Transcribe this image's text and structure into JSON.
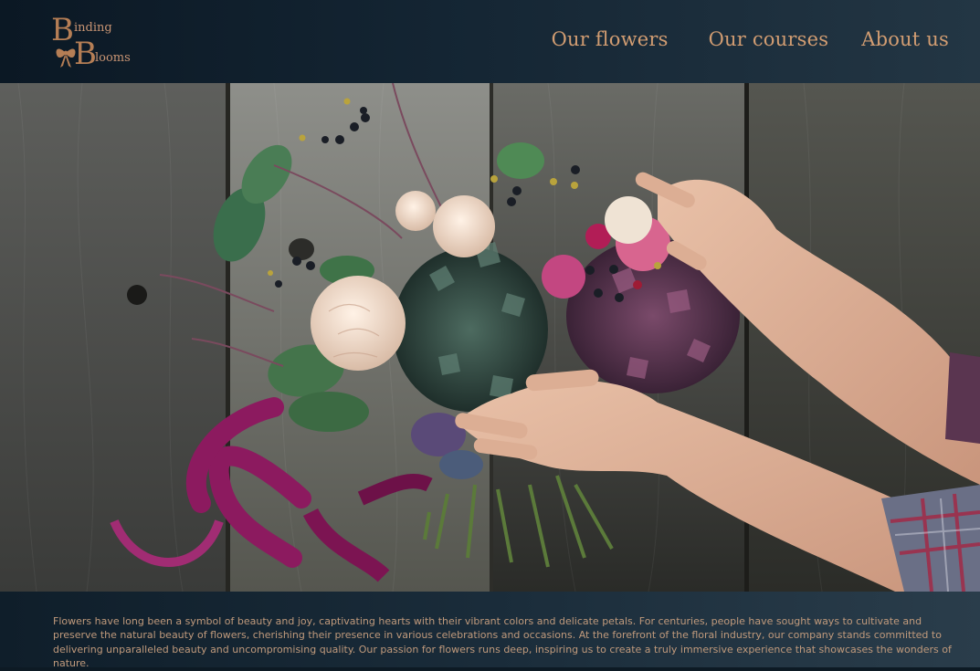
{
  "brand": {
    "logo_text": "Binding Blooms"
  },
  "nav": {
    "items": [
      {
        "label": "Our flowers"
      },
      {
        "label": "Our courses"
      },
      {
        "label": "About us"
      }
    ]
  },
  "hero": {
    "image": "bouquet-on-wooden-table"
  },
  "footer": {
    "text": "Flowers have long been a symbol of beauty and joy, captivating hearts with their vibrant colors and delicate petals. For centuries, people have sought ways to cultivate and preserve the natural beauty of flowers, cherishing their presence in various celebrations and occasions. At the forefront of the floral industry, our company stands committed to delivering unparalleled beauty and uncompromising quality. Our passion for flowers runs deep, inspiring us to create a truly immersive experience that showcases the wonders of nature."
  },
  "colors": {
    "accent": "#d29d72",
    "header_dark": "#0b1824",
    "footer_text": "#c09a7c"
  }
}
